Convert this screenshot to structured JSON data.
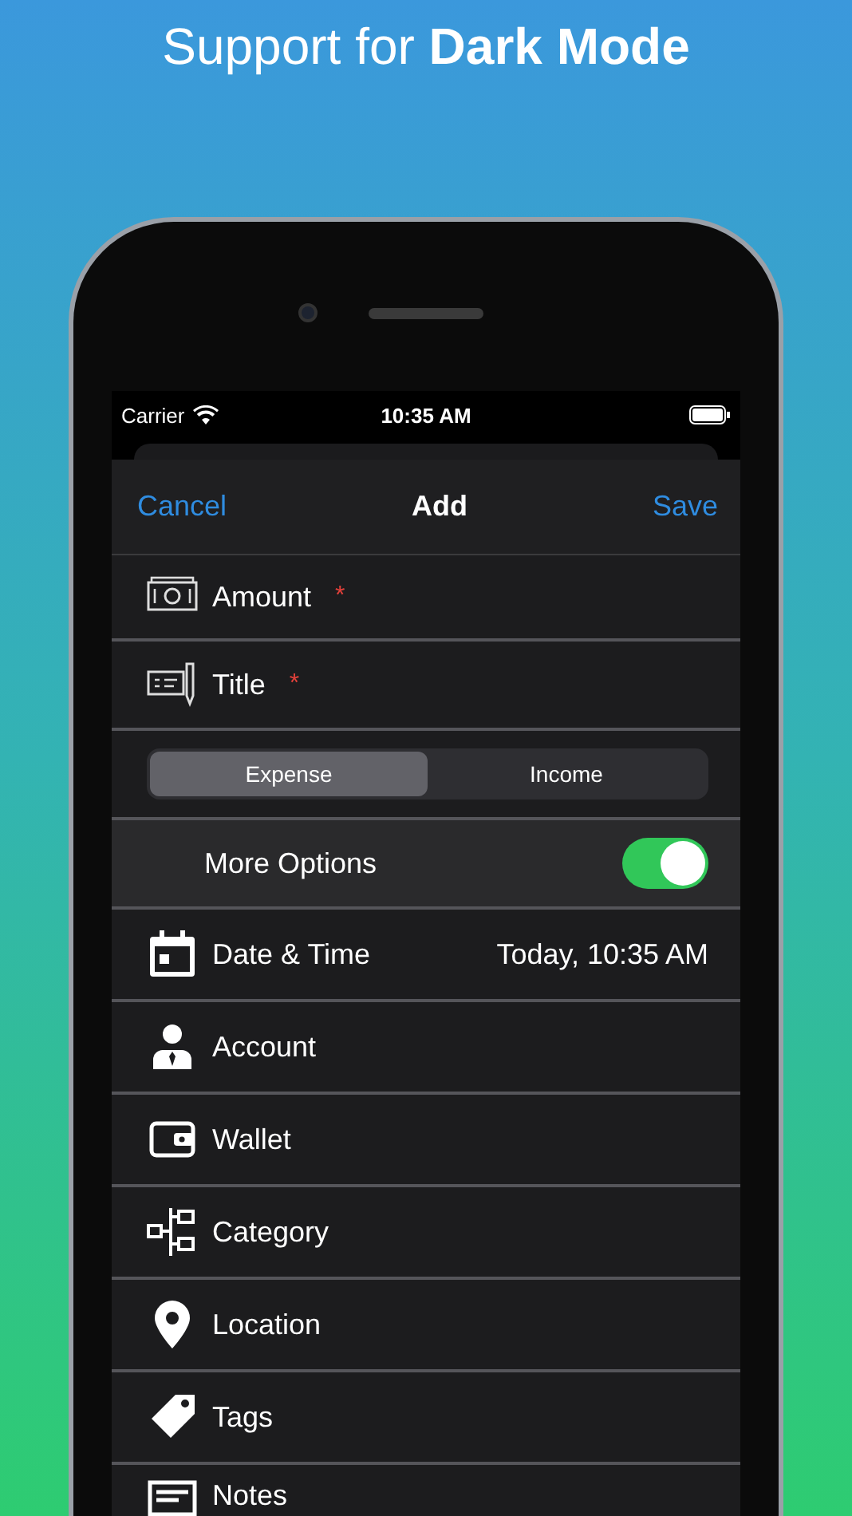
{
  "headline": "Support for **Dark Mode**",
  "status_bar": {
    "carrier": "Carrier",
    "time": "10:35 AM"
  },
  "nav": {
    "cancel": "Cancel",
    "title": "Add",
    "save": "Save"
  },
  "fields": [
    {
      "kind": "cash",
      "label": "Amount",
      "required_mark": "*"
    },
    {
      "kind": "check",
      "label": "Title",
      "required_mark": "*"
    }
  ],
  "segments": [
    {
      "label": "Expense",
      "selected": true
    },
    {
      "label": "Income",
      "selected": false
    }
  ],
  "more_options": {
    "label": "More Options",
    "on": true
  },
  "rows": [
    {
      "kind": "calendar",
      "label": "Date & Time",
      "value": "Today, 10:35 AM"
    },
    {
      "kind": "person",
      "label": "Account"
    },
    {
      "kind": "wallet",
      "label": "Wallet"
    },
    {
      "kind": "hierarchy",
      "label": "Category"
    },
    {
      "kind": "pin",
      "label": "Location"
    },
    {
      "kind": "tag",
      "label": "Tags"
    },
    {
      "kind": "notes",
      "label": "Notes"
    }
  ]
}
